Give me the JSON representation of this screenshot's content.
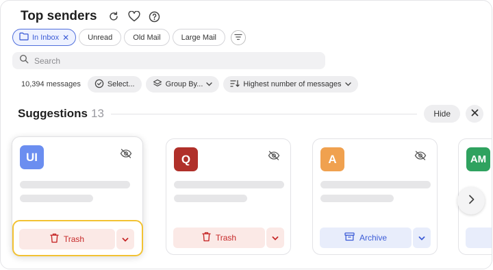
{
  "header": {
    "title": "Top senders",
    "icons": [
      "refresh-icon",
      "heart-icon",
      "help-icon"
    ]
  },
  "filters": {
    "chips": [
      {
        "label": "In Inbox",
        "active": true,
        "icon": "folder-icon"
      },
      {
        "label": "Unread",
        "active": false
      },
      {
        "label": "Old Mail",
        "active": false
      },
      {
        "label": "Large Mail",
        "active": false
      }
    ],
    "remove_glyph": "✕"
  },
  "search": {
    "placeholder": "Search",
    "value": ""
  },
  "toolbar": {
    "count": "10,394 messages",
    "select_label": "Select...",
    "group_label": "Group By...",
    "sort_label": "Highest number of messages"
  },
  "suggestions": {
    "title": "Suggestions",
    "count": "13",
    "hide_label": "Hide"
  },
  "cards": [
    {
      "initials": "UI",
      "color": "#6b8ef0",
      "action": "Trash",
      "action_type": "trash"
    },
    {
      "initials": "Q",
      "color": "#b0302a",
      "action": "Trash",
      "action_type": "trash"
    },
    {
      "initials": "A",
      "color": "#f0a14f",
      "action": "Archive",
      "action_type": "archive"
    },
    {
      "initials": "AM",
      "color": "#2fa25f",
      "action": "",
      "action_type": "archive"
    }
  ],
  "colors": {
    "accent": "#3b5bd6",
    "trash": "#c62828",
    "highlight": "#f2c232"
  }
}
